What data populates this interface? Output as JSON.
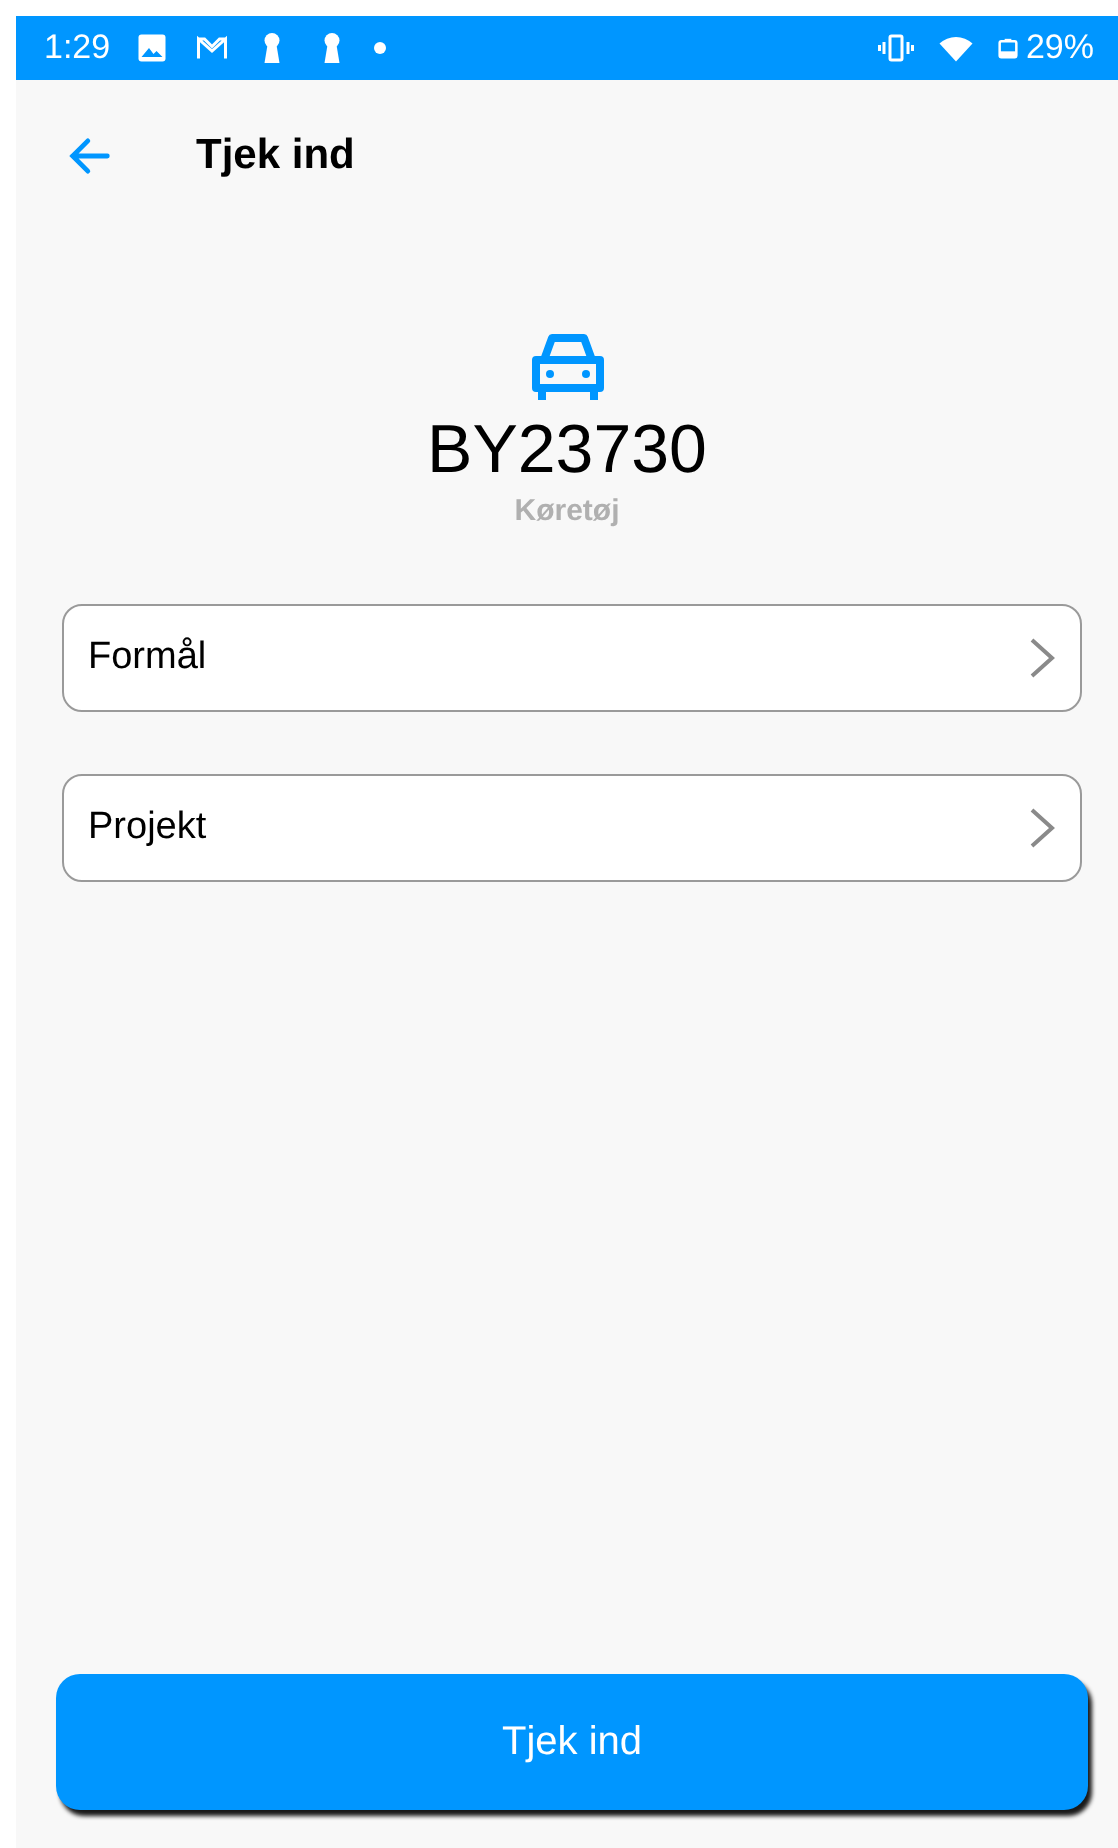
{
  "status_bar": {
    "time": "1:29",
    "battery": "29%"
  },
  "header": {
    "title": "Tjek ind"
  },
  "vehicle": {
    "plate": "BY23730",
    "type": "Køretøj"
  },
  "fields": [
    {
      "label": "Formål"
    },
    {
      "label": "Projekt"
    }
  ],
  "submit_button": {
    "label": "Tjek ind"
  }
}
